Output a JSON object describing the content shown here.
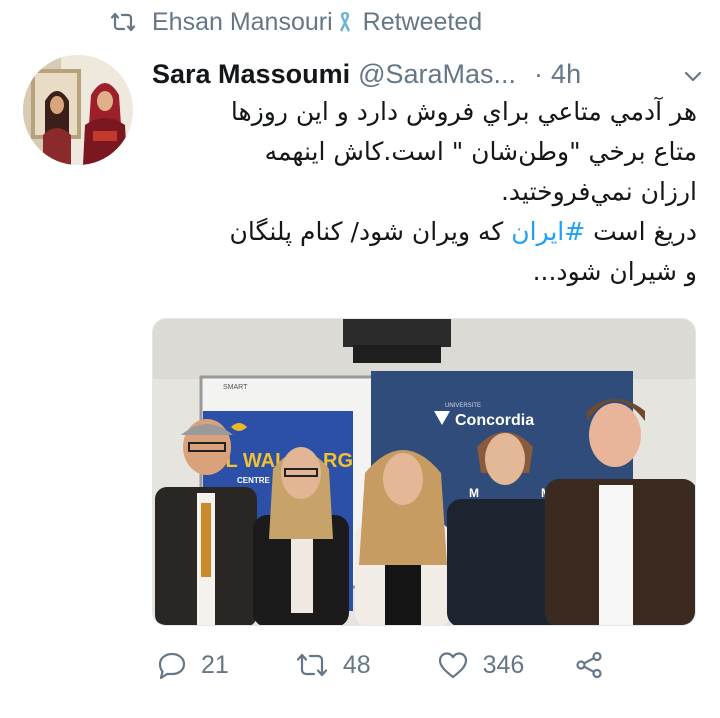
{
  "retweet": {
    "icon": "retweet-icon",
    "user": "Ehsan Mansouri",
    "badge_icon": "ribbon-icon",
    "label": "Retweeted"
  },
  "tweet": {
    "author_name": "Sara Massoumi",
    "handle": "@SaraMas...",
    "separator": "·",
    "time": "4h",
    "menu_icon": "chevron-down-icon",
    "text_lines": [
      "هر آدمي متاعي براي فروش دارد و اين روزها",
      "متاع برخي \"وطن‌شان \" است.کاش اينهمه",
      "ارزان نمي‌فروختيد.",
      "دريغ است #ايران که ويران شود/ کنام پلنگان",
      "و شيران شود..."
    ],
    "text_line_4_before": "دريغ است ",
    "text_hashtag": "#ايران",
    "text_line_4_after": " که ويران شود/ کنام پلنگان"
  },
  "photo": {
    "banner_left_text": "UL WAL",
    "banner_left_suffix": "RG",
    "banner_left_sub": "CENTRE FOR H",
    "banner_right_brand": "Concordia",
    "banner_right_small": "UNIVERSITE",
    "banner_right_tag1": "M",
    "banner_right_tag2": "MIGS",
    "whiteboard_brand": "SMART"
  },
  "actions": {
    "reply_icon": "reply-icon",
    "reply_count": "21",
    "retweet_icon": "retweet-icon",
    "retweet_count": "48",
    "like_icon": "heart-icon",
    "like_count": "346",
    "share_icon": "share-icon"
  },
  "colors": {
    "secondary_text": "#657786",
    "link": "#1da1f2",
    "ribbon": "#6bb3d6"
  }
}
